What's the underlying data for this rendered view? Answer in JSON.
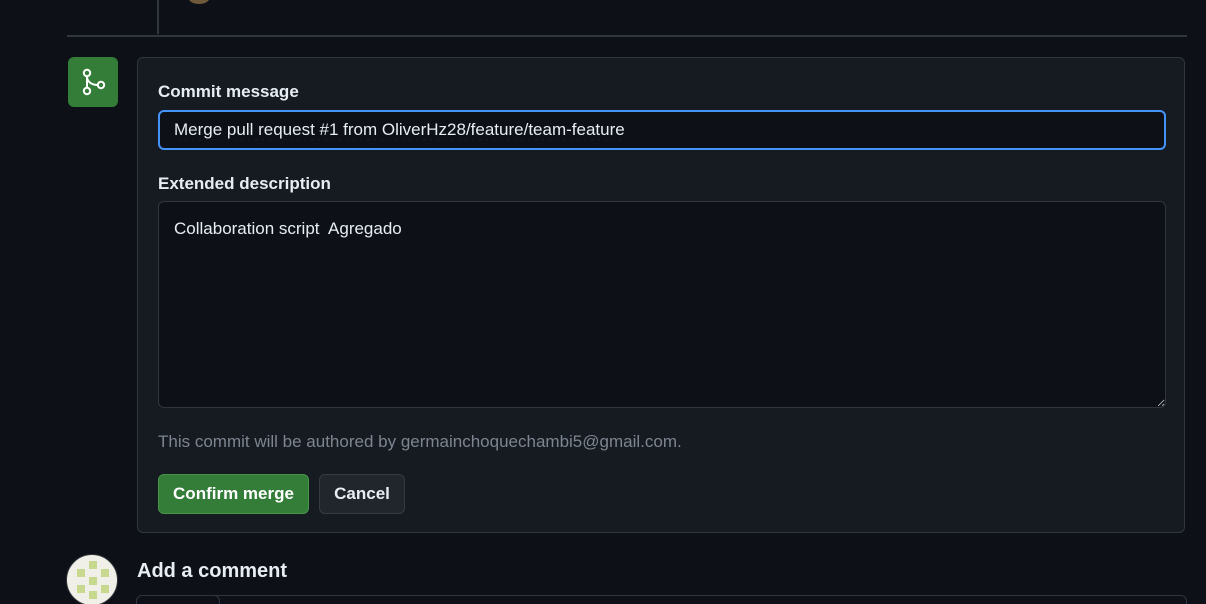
{
  "merge_form": {
    "icon": "git-merge-icon",
    "commit_message_label": "Commit message",
    "commit_message_value": "Merge pull request #1 from OliverHz28/feature/team-feature",
    "extended_description_label": "Extended description",
    "extended_description_value": "Collaboration script  Agregado",
    "author_note": "This commit will be authored by germainchoquechambi5@gmail.com.",
    "confirm_label": "Confirm merge",
    "cancel_label": "Cancel"
  },
  "comment": {
    "heading": "Add a comment"
  },
  "colors": {
    "background": "#0d1117",
    "panel": "#161b22",
    "border": "#30363d",
    "accent_green": "#347d39",
    "focus_blue": "#4493f8",
    "muted_text": "#7d8590"
  }
}
